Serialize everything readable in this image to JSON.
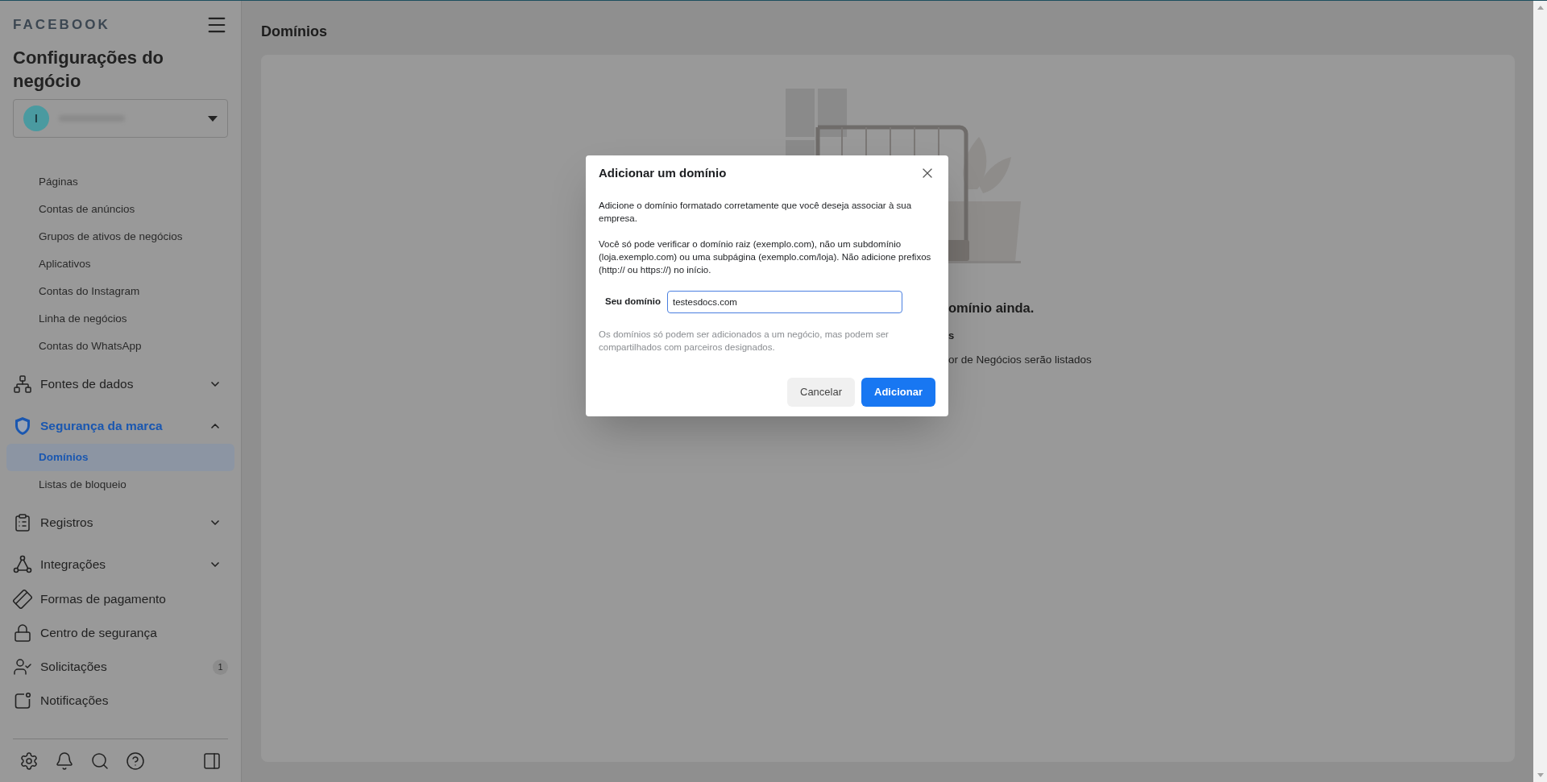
{
  "sidebar": {
    "brand": "FACEBOOK",
    "title": "Configurações do negócio",
    "account": {
      "initial": "I"
    },
    "nav": [
      {
        "kind": "subitem",
        "label": "Páginas",
        "selected": false
      },
      {
        "kind": "subitem",
        "label": "Contas de anúncios",
        "selected": false
      },
      {
        "kind": "subitem",
        "label": "Grupos de ativos de negócios",
        "selected": false
      },
      {
        "kind": "subitem",
        "label": "Aplicativos",
        "selected": false
      },
      {
        "kind": "subitem",
        "label": "Contas do Instagram",
        "selected": false
      },
      {
        "kind": "subitem",
        "label": "Linha de negócios",
        "selected": false
      },
      {
        "kind": "subitem",
        "label": "Contas do WhatsApp",
        "selected": false
      },
      {
        "kind": "group",
        "label": "Fontes de dados",
        "expanded": false,
        "active": false
      },
      {
        "kind": "group",
        "label": "Segurança da marca",
        "expanded": true,
        "active": true
      },
      {
        "kind": "subitem",
        "label": "Domínios",
        "selected": true
      },
      {
        "kind": "subitem",
        "label": "Listas de bloqueio",
        "selected": false
      },
      {
        "kind": "group",
        "label": "Registros",
        "expanded": false,
        "active": false
      },
      {
        "kind": "group",
        "label": "Integrações",
        "expanded": false,
        "active": false
      },
      {
        "kind": "link",
        "label": "Formas de pagamento"
      },
      {
        "kind": "link",
        "label": "Centro de segurança"
      },
      {
        "kind": "link",
        "label": "Solicitações",
        "badge": "1"
      },
      {
        "kind": "link",
        "label": "Notificações"
      }
    ]
  },
  "main": {
    "title": "Domínios",
    "empty_state": {
      "heading": "omínio ainda.",
      "line_1": "s",
      "line_2": "or de Negócios serão listados"
    }
  },
  "dialog": {
    "title": "Adicionar um domínio",
    "paragraphs": [
      "Adicione o domínio formatado corretamente que você deseja associar à sua empresa.",
      "Você só pode verificar o domínio raiz (exemplo.com), não um subdomínio (loja.exemplo.com) ou uma subpágina (exemplo.com/loja). Não adicione prefixos (http:// ou https://) no início."
    ],
    "field": {
      "label": "Seu domínio",
      "value": "testesdocs.com"
    },
    "note": "Os domínios só podem ser adicionados a um negócio, mas podem ser compartilhados com parceiros designados.",
    "buttons": [
      {
        "kind": "secondary",
        "label": "Cancelar"
      },
      {
        "kind": "primary",
        "label": "Adicionar"
      }
    ]
  }
}
